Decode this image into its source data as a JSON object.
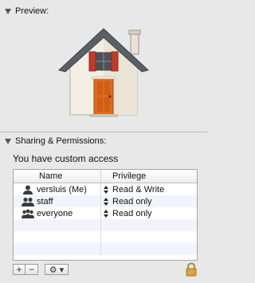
{
  "preview": {
    "title": "Preview:"
  },
  "sharing": {
    "title": "Sharing & Permissions:",
    "status": "You have custom access",
    "columns": {
      "name": "Name",
      "privilege": "Privilege"
    },
    "rows": [
      {
        "name": "versluis (Me)",
        "privilege": "Read & Write",
        "icon": "single-user-icon"
      },
      {
        "name": "staff",
        "privilege": "Read only",
        "icon": "group-icon"
      },
      {
        "name": "everyone",
        "privilege": "Read only",
        "icon": "everyone-group-icon"
      }
    ],
    "buttons": {
      "add": "+",
      "remove": "−",
      "action": "⚙ ▾"
    }
  },
  "colors": {
    "roof": "#5b5f66",
    "wall": "#f4efe4",
    "door": "#e06a1c",
    "shutter": "#c23a2a"
  }
}
